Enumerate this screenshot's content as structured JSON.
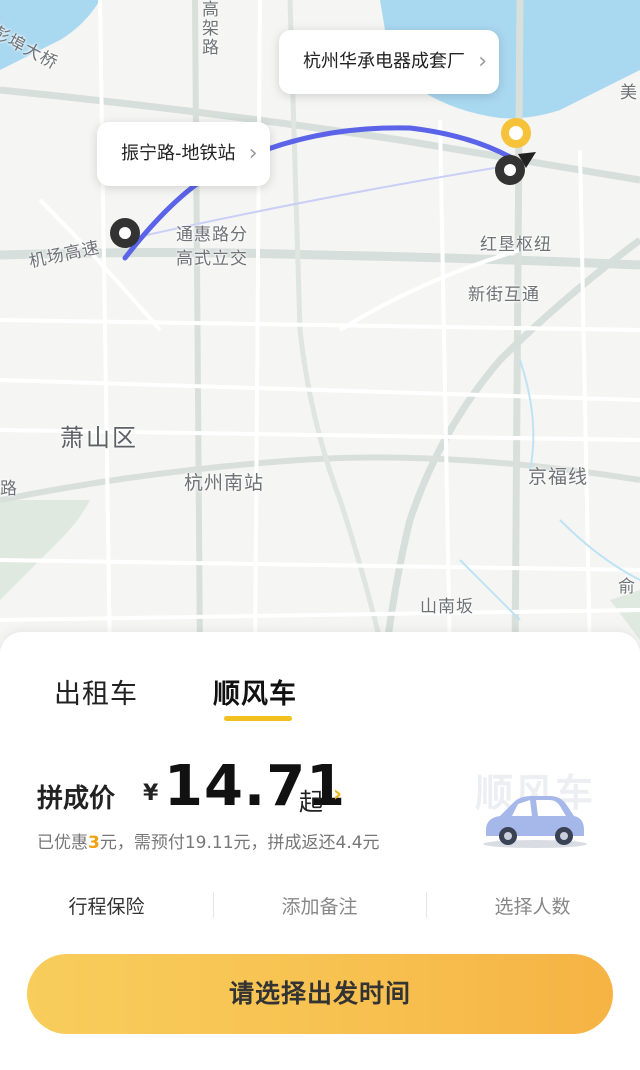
{
  "map": {
    "labels": {
      "bridge": "彭埠大桥",
      "elevated": "高架路",
      "airport_hwy": "机场高速",
      "tonghui_line1": "通惠路分",
      "tonghui_line2": "高式立交",
      "hongken": "红垦枢纽",
      "xinjie": "新街互通",
      "xiaoshan": "萧山区",
      "south_station": "杭州南站",
      "jingfu": "京福线",
      "shannanban": "山南坂",
      "left_road": "路",
      "right_edge_top": "美",
      "right_edge_bottom": "俞"
    },
    "bubbles": {
      "destination": "杭州华承电器成套厂",
      "origin": "振宁路-地铁站"
    },
    "colors": {
      "route": "#5b64e8",
      "water": "#a7d7f0",
      "road": "#ffffff",
      "major_road": "#d8dfdb"
    }
  },
  "panel": {
    "tabs": [
      {
        "label": "出租车",
        "active": false
      },
      {
        "label": "顺风车",
        "active": true
      }
    ],
    "price": {
      "label": "拼成价",
      "currency": "¥",
      "value": "14.71",
      "suffix": "起",
      "arrow": "›"
    },
    "discount": {
      "prefix": "已优惠",
      "amount": "3",
      "rest": "元，需预付19.11元，拼成返还4.4元"
    },
    "ghost_title": "顺风车",
    "car_icon": "car-icon",
    "options": [
      "行程保险",
      "添加备注",
      "选择人数"
    ],
    "cta": "请选择出发时间",
    "accent": "#f3c11f"
  }
}
